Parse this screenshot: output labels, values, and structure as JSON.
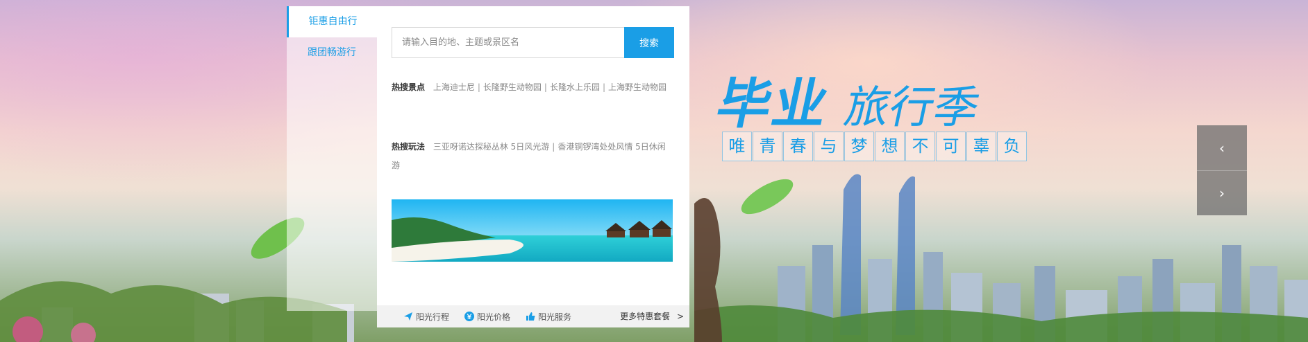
{
  "tabs": [
    {
      "label": "钜惠自由行"
    },
    {
      "label": "跟团畅游行"
    }
  ],
  "search": {
    "placeholder": "请输入目的地、主题或景区名",
    "button_label": "搜索"
  },
  "hot_spots": {
    "label": "热搜景点",
    "items": [
      "上海迪士尼",
      "长隆野生动物园",
      "长隆水上乐园",
      "上海野生动物园"
    ]
  },
  "hot_ways": {
    "label": "热搜玩法",
    "items": [
      "三亚呀诺达探秘丛林 5日风光游",
      "香港铜锣湾处处风情 5日休闲游"
    ]
  },
  "bottom_bar": {
    "items": [
      {
        "label": "阳光行程",
        "icon": "plane-icon"
      },
      {
        "label": "阳光价格",
        "icon": "yen-icon"
      },
      {
        "label": "阳光服务",
        "icon": "thumbs-up-icon"
      }
    ],
    "more_label": "更多特惠套餐",
    "more_arrow": ">"
  },
  "slogan": {
    "main_1": "毕业",
    "main_2": "旅行季",
    "sub_chars": [
      "唯",
      "青",
      "春",
      "与",
      "梦",
      "想",
      "不",
      "可",
      "辜",
      "负"
    ]
  },
  "carousel": {
    "prev": "‹",
    "next": "›"
  },
  "colors": {
    "accent": "#1a9ee6"
  }
}
